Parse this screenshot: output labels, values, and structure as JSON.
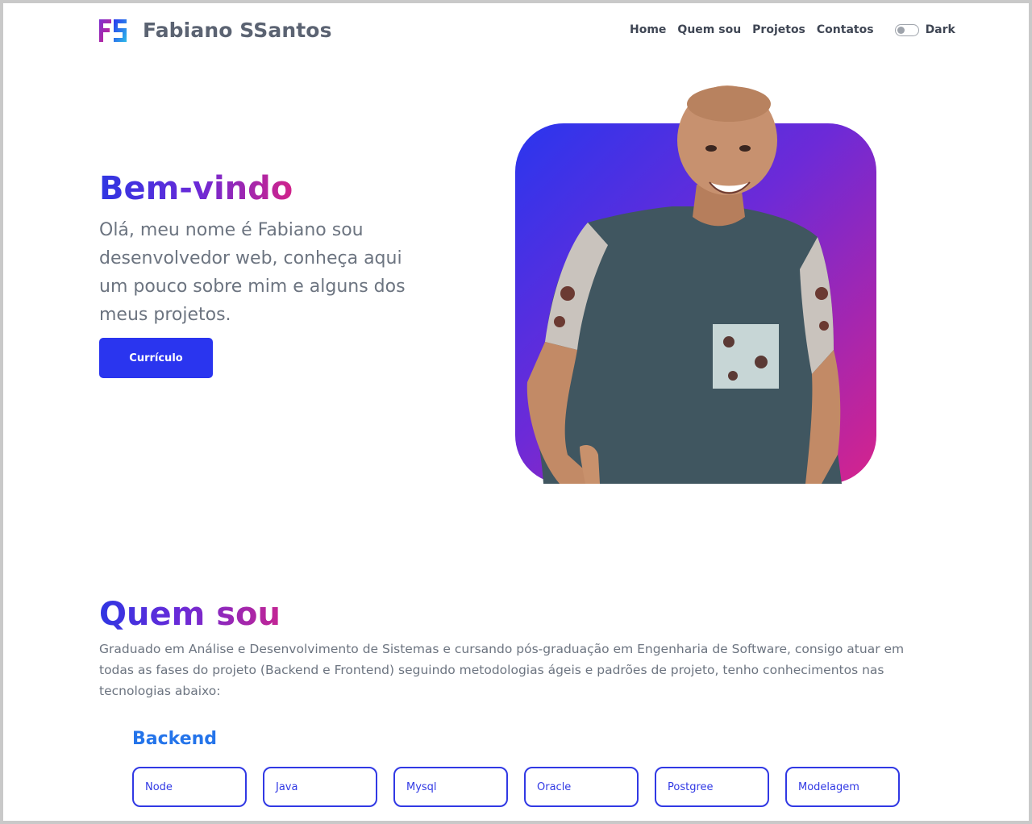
{
  "brand": {
    "name": "Fabiano SSantos",
    "logo_text": "FS"
  },
  "nav": {
    "links": [
      "Home",
      "Quem sou",
      "Projetos",
      "Contatos"
    ],
    "theme_toggle_label": "Dark"
  },
  "hero": {
    "title": "Bem-vindo",
    "text": "Olá, meu nome é Fabiano sou desenvolvedor web, conheça aqui um pouco sobre mim e alguns dos meus projetos.",
    "button_label": "Currículo"
  },
  "about": {
    "title": "Quem sou",
    "text": "Graduado em Análise e Desenvolvimento de Sistemas e cursando pós-graduação em Engenharia de Software, consigo atuar em todas as fases do projeto (Backend e Frontend) seguindo metodologias ágeis e padrões de projeto, tenho conhecimentos nas tecnologias abaixo:"
  },
  "backend": {
    "title": "Backend",
    "skills": [
      "Node",
      "Java",
      "Mysql",
      "Oracle",
      "Postgree",
      "Modelagem"
    ]
  },
  "colors": {
    "accent": "#2a35ef",
    "gradient_start": "#2f36e2",
    "gradient_end": "#d1238a",
    "backend_title": "#2474ea"
  }
}
